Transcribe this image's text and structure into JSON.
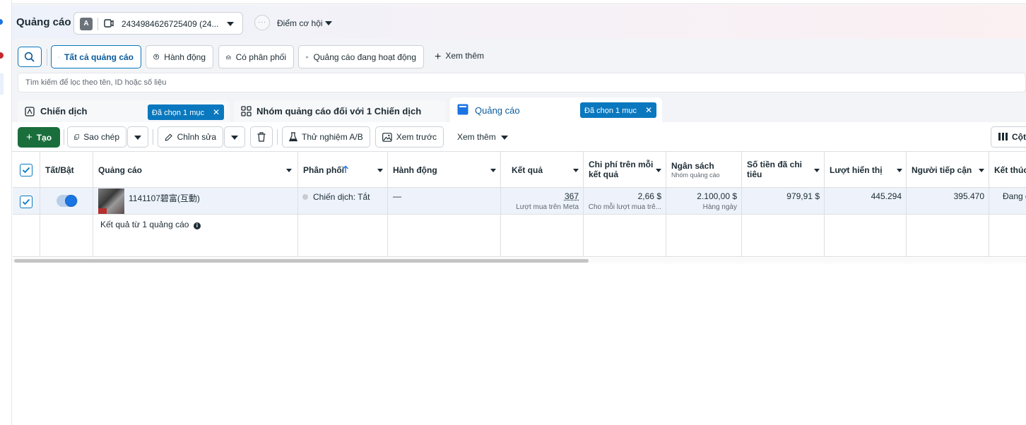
{
  "header": {
    "title": "Quảng cáo",
    "account_avatar": "A",
    "account_id": "2434984626725409 (24...",
    "opportunity_label": "Điểm cơ hội"
  },
  "filters": {
    "items": [
      {
        "label": "Tất cả quảng cáo",
        "icon": "folder-icon",
        "active": true
      },
      {
        "label": "Hành động",
        "icon": "arrow-up-circle-icon"
      },
      {
        "label": "Có phân phối",
        "icon": "envelope-open-icon"
      },
      {
        "label": "Quảng cáo đang hoạt động",
        "icon": "send-icon"
      }
    ],
    "more_label": "Xem thêm",
    "search_placeholder": "Tìm kiếm để lọc theo tên, ID hoặc số liệu"
  },
  "tabs": [
    {
      "label": "Chiến dịch",
      "chip": "Đã chọn 1 mục",
      "icon": "campaign-icon"
    },
    {
      "label": "Nhóm quảng cáo đối với 1 Chiến dịch",
      "icon": "grid-icon"
    },
    {
      "label": "Quảng cáo",
      "chip": "Đã chọn 1 mục",
      "icon": "ad-icon",
      "active": true
    }
  ],
  "toolbar": {
    "create": "Tạo",
    "duplicate": "Sao chép",
    "edit": "Chỉnh sửa",
    "ab_test": "Thử nghiệm A/B",
    "preview": "Xem trước",
    "see_more": "Xem thêm",
    "columns": "Cột:"
  },
  "table": {
    "headers": {
      "toggle": "Tất/Bật",
      "ad": "Quảng cáo",
      "delivery": "Phân phối",
      "actions": "Hành động",
      "results": "Kết quả",
      "cost_per_result_1": "Chi phí trên mỗi",
      "cost_per_result_2": "kết quả",
      "budget": "Ngân sách",
      "budget_sub": "Nhóm quảng cáo",
      "amount_spent_1": "Số tiền đã chi",
      "amount_spent_2": "tiêu",
      "impressions": "Lượt hiển thị",
      "reach": "Người tiếp cận",
      "ends": "Kết thúc"
    },
    "row": {
      "ad_name": "1141107碧富(互動)",
      "delivery": "Chiến dịch: Tắt",
      "actions": "—",
      "results": "367",
      "results_sub": "Lượt mua trên Meta",
      "cost_per_result": "2,66 $",
      "cost_per_result_sub": "Cho mỗi lượt mua trê...",
      "budget": "2.100,00 $",
      "budget_sub": "Hàng ngày",
      "amount_spent": "979,91 $",
      "impressions": "445.294",
      "reach": "395.470",
      "ends": "Đang d"
    },
    "summary": "Kết quả từ 1 quảng cáo"
  },
  "colors": {
    "accent": "#0a78be",
    "create_green": "#1a6e3b",
    "toggle_blue": "#1b74e4"
  }
}
